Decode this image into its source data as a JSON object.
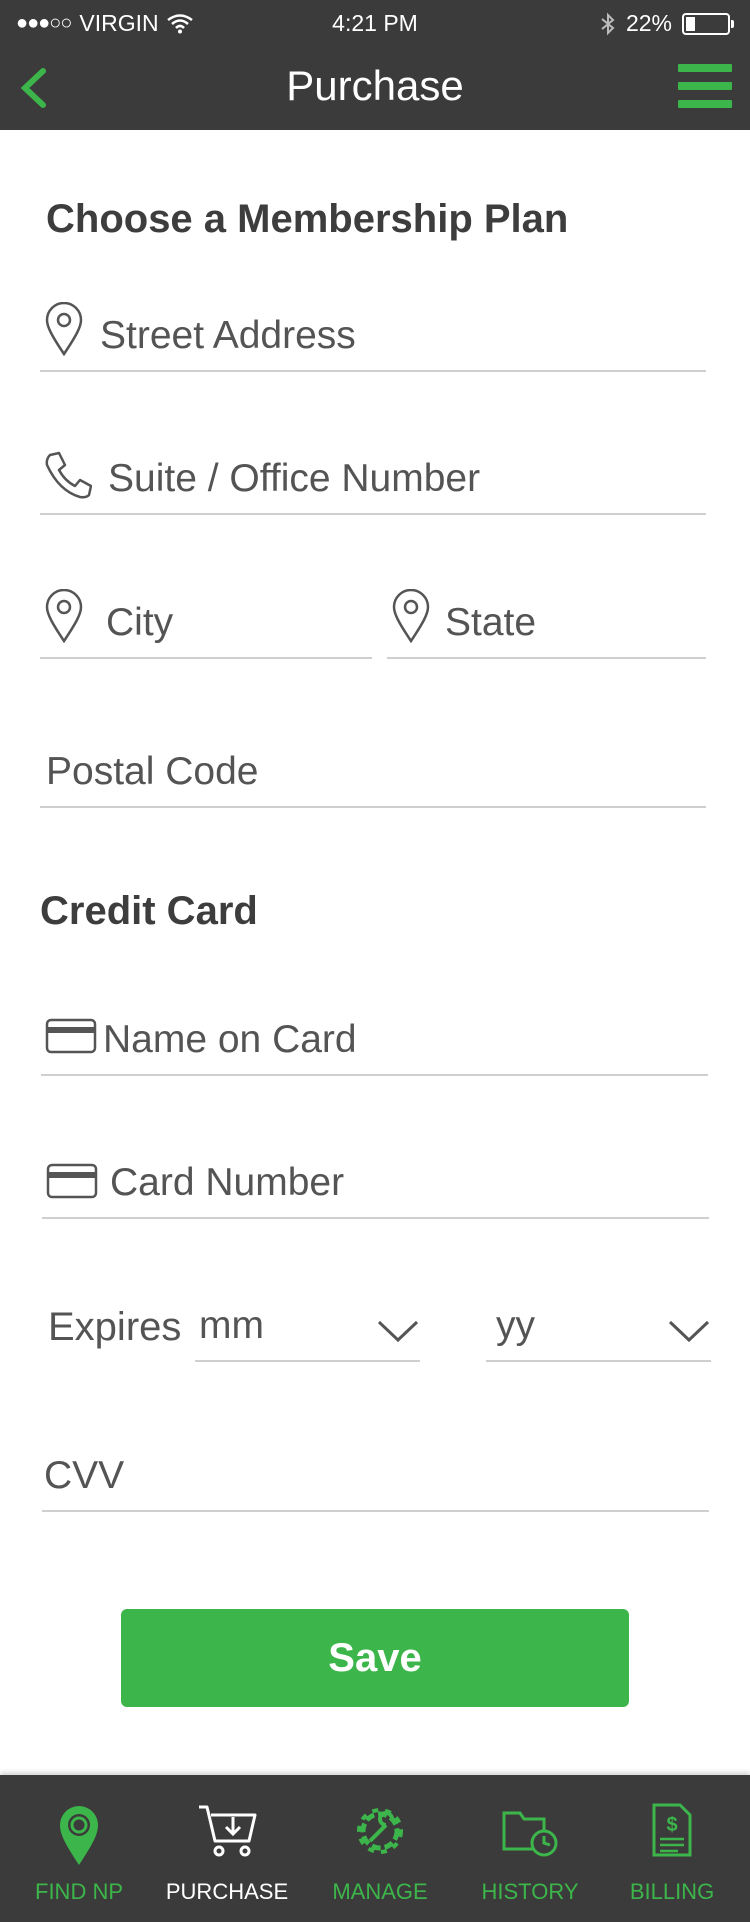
{
  "status_bar": {
    "signal": "●●●○○",
    "carrier": "VIRGIN",
    "time": "4:21 PM",
    "battery_text": "22%",
    "battery_level": 0.22
  },
  "header": {
    "title": "Purchase",
    "back_icon": "chevron-left-icon",
    "menu_icon": "hamburger-menu-icon"
  },
  "membership": {
    "section_title": "Choose a Membership Plan",
    "street_placeholder": "Street Address",
    "suite_placeholder": "Suite / Office Number",
    "city_placeholder": "City",
    "state_placeholder": "State",
    "postal_placeholder": "Postal Code"
  },
  "credit_card": {
    "section_title": "Credit Card",
    "name_placeholder": "Name on Card",
    "number_placeholder": "Card Number",
    "expires_label": "Expires",
    "month_placeholder": "mm",
    "year_placeholder": "yy",
    "cvv_placeholder": "CVV"
  },
  "actions": {
    "save_label": "Save"
  },
  "tabs": [
    {
      "label": "FIND NP",
      "icon": "location-pin-icon",
      "active": false
    },
    {
      "label": "PURCHASE",
      "icon": "cart-icon",
      "active": true
    },
    {
      "label": "MANAGE",
      "icon": "gear-wrench-icon",
      "active": false
    },
    {
      "label": "HISTORY",
      "icon": "folder-clock-icon",
      "active": false
    },
    {
      "label": "BILLING",
      "icon": "invoice-icon",
      "active": false
    }
  ],
  "colors": {
    "accent": "#3cb54a",
    "bar_background": "#3b3b3b",
    "text": "#545454",
    "divider": "#cfcfcf"
  }
}
